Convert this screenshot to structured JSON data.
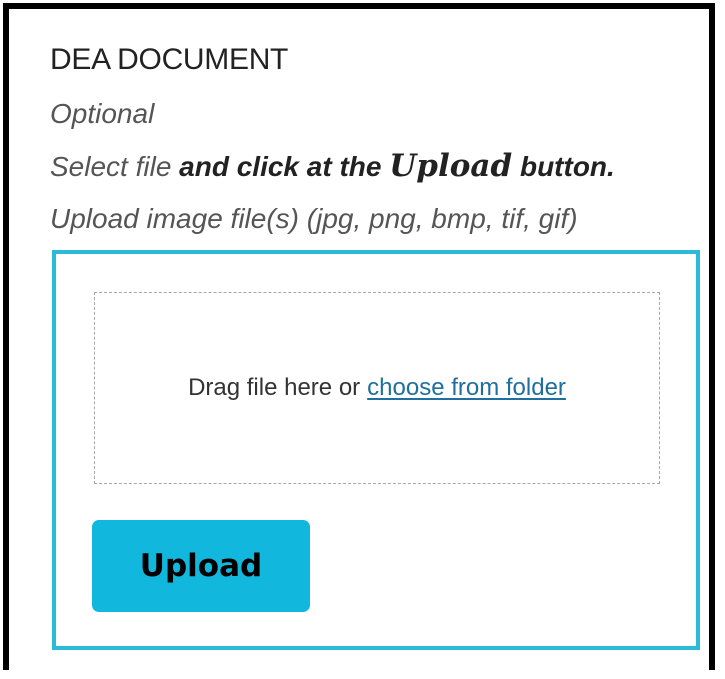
{
  "section": {
    "title": "DEA DOCUMENT",
    "optional_label": "Optional",
    "instruction_prefix": "Select file ",
    "instruction_bold": "and click at the ",
    "instruction_upload_word": "Upload",
    "instruction_suffix": " button.",
    "file_types_hint": "Upload image file(s) (jpg, png, bmp, tif, gif)"
  },
  "dropzone": {
    "prompt": "Drag file here or",
    "link_label": "choose from folder"
  },
  "actions": {
    "upload_label": "Upload"
  },
  "colors": {
    "panel_border": "#2bbbd6",
    "button_bg": "#11b7dd",
    "link": "#1f6f9f"
  }
}
